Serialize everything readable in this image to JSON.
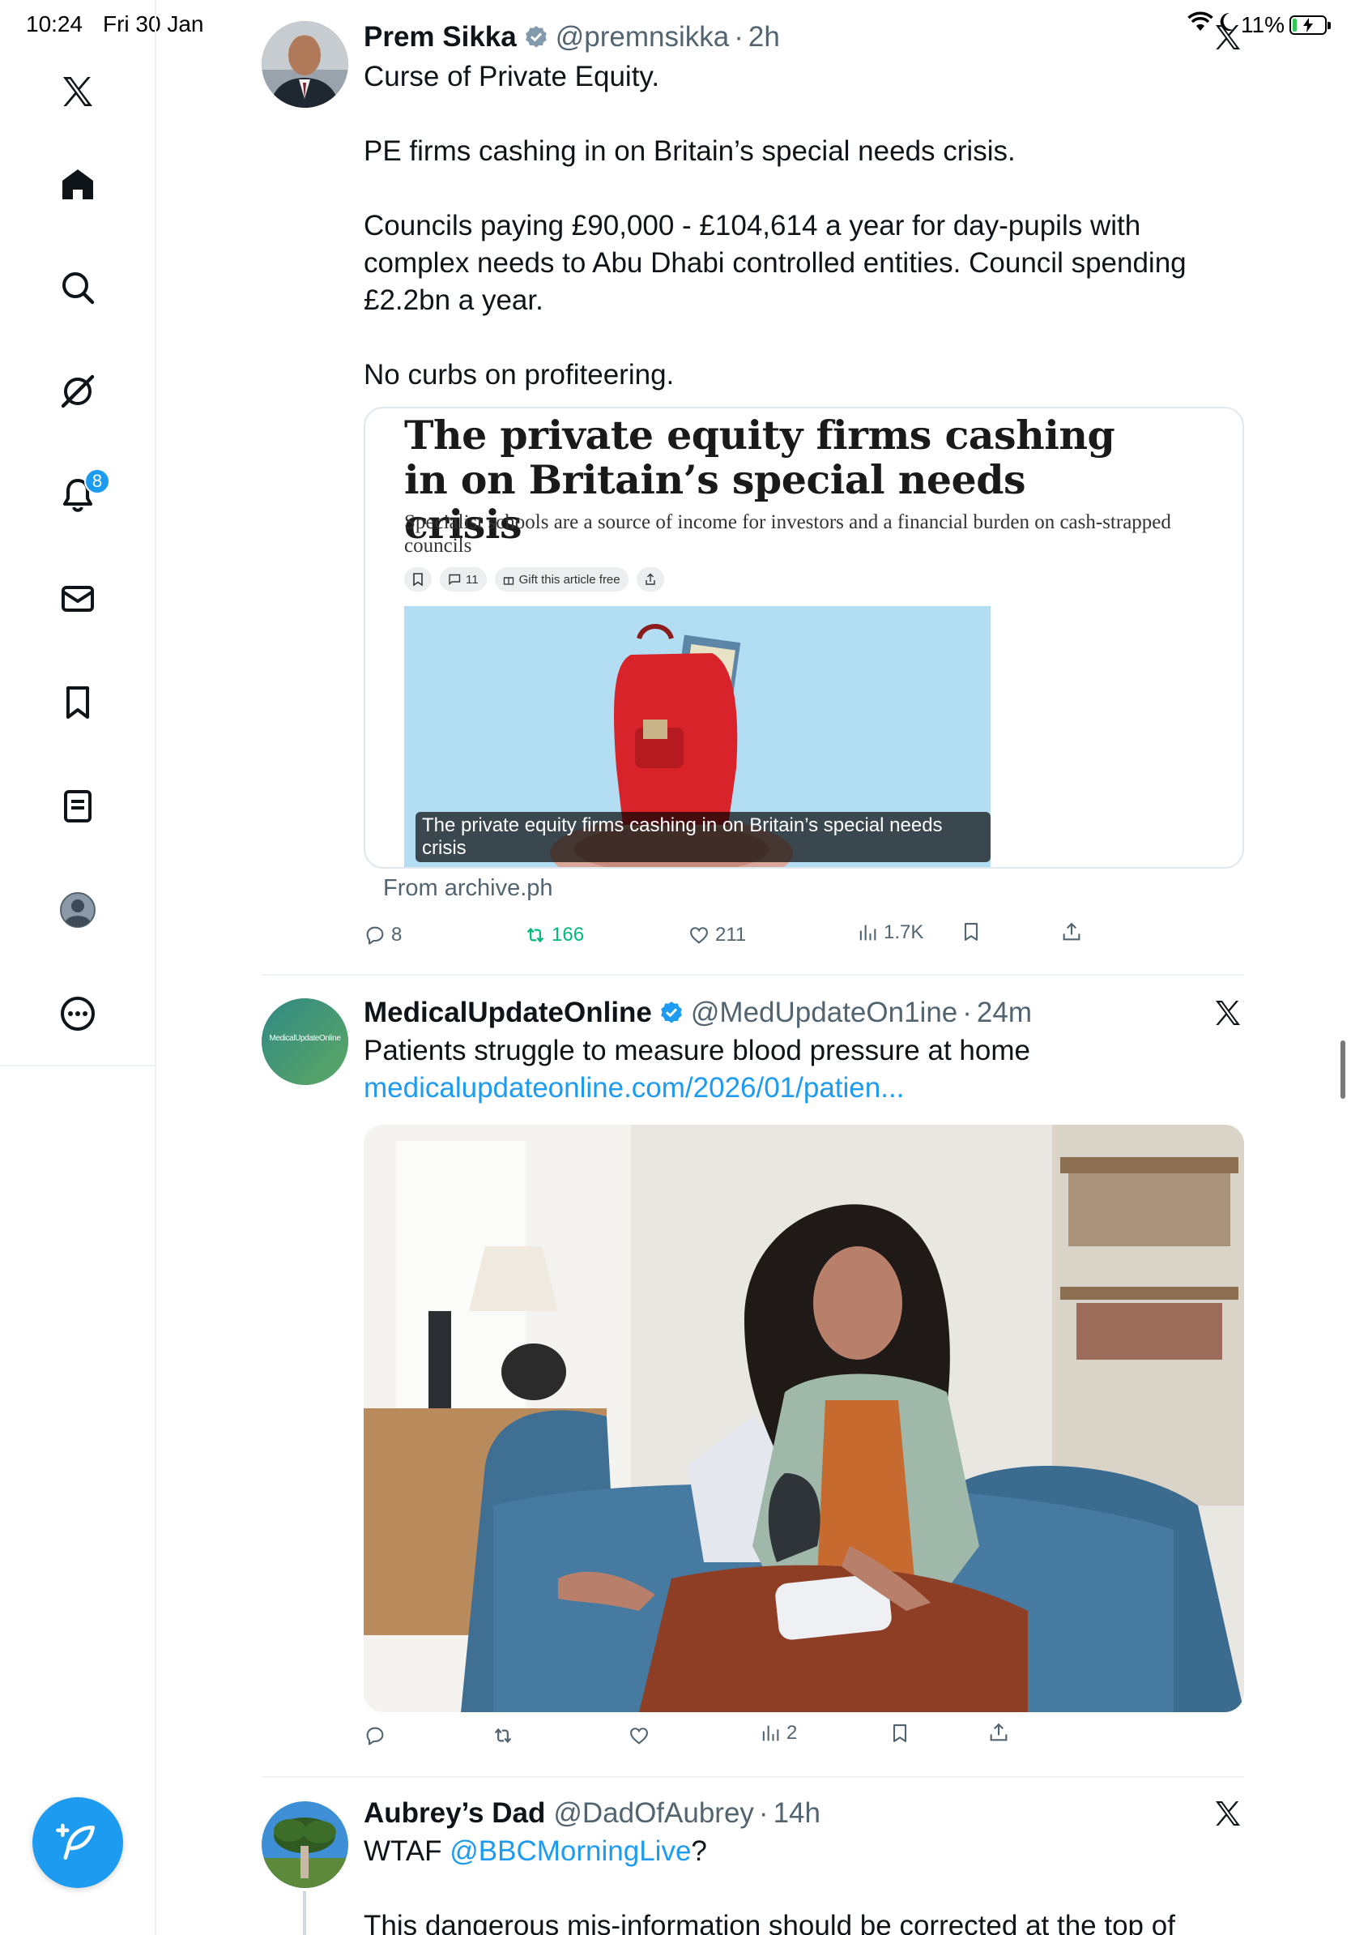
{
  "status_bar": {
    "time": "10:24",
    "date": "Fri 30 Jan",
    "battery": "11%",
    "battery_level": 0.11
  },
  "sidebar": {
    "items": [
      {
        "icon": "x-logo-icon"
      },
      {
        "icon": "home-icon"
      },
      {
        "icon": "search-icon"
      },
      {
        "icon": "grok-icon"
      },
      {
        "icon": "notifications-bell-icon",
        "badge": "8"
      },
      {
        "icon": "messages-envelope-icon"
      },
      {
        "icon": "bookmark-icon"
      },
      {
        "icon": "lists-icon"
      },
      {
        "icon": "profile-avatar-icon"
      },
      {
        "icon": "more-icon"
      }
    ],
    "compose_icon": "compose-feather-icon"
  },
  "tweets": [
    {
      "name": "Prem Sikka",
      "verified": true,
      "handle": "@premnsikka",
      "sep": "·",
      "time": "2h",
      "paragraphs": [
        "Curse of Private Equity.",
        "PE firms cashing in on Britain’s special needs crisis.",
        "Councils paying £90,000 - £104,614 a year for day-pupils with complex needs to Abu Dhabi controlled entities. Council spending £2.2bn a year.",
        "No curbs on profiteering."
      ],
      "card": {
        "headline": "The private equity firms cashing in on Britain’s special needs crisis",
        "subheading": "Specialist schools are a source of income for investors and a financial burden on cash-strapped councils",
        "tools": {
          "comments": "11",
          "gift": "Gift this article free"
        },
        "image_caption": "The private equity firms cashing in on Britain’s special needs crisis",
        "from": "From archive.ph"
      },
      "actions": {
        "replies": "8",
        "reposts": "166",
        "likes": "211",
        "views": "1.7K"
      }
    },
    {
      "name": "MedicalUpdateOnline",
      "verified": true,
      "handle": "@MedUpdateOn1ine",
      "sep": "·",
      "time": "24m",
      "avatar_text": "MedicalUpdateOnline",
      "text": "Patients struggle to measure blood pressure at home",
      "link": "medicalupdateonline.com/2026/01/patien...",
      "actions": {
        "replies": "",
        "reposts": "",
        "likes": "",
        "views": "2"
      }
    },
    {
      "name": "Aubrey’s Dad",
      "verified": false,
      "handle": "@DadOfAubrey",
      "sep": "·",
      "time": "14h",
      "text_prefix": "WTAF ",
      "mention": "@BBCMorningLive",
      "text_suffix": "?",
      "text2": "This dangerous mis-information should be corrected at the top of"
    }
  ],
  "colors": {
    "accent": "#1d9bf0",
    "repost": "#00ba7c",
    "muted": "#536471"
  }
}
